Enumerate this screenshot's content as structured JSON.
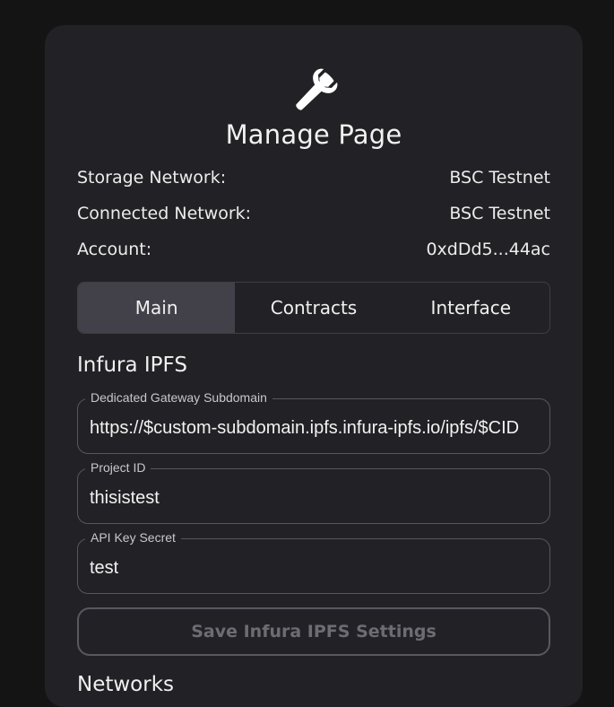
{
  "page": {
    "title": "Manage Page",
    "icon": "wrench-icon"
  },
  "info": [
    {
      "label": "Storage Network:",
      "value": "BSC Testnet"
    },
    {
      "label": "Connected Network:",
      "value": "BSC Testnet"
    },
    {
      "label": "Account:",
      "value": "0xdDd5...44ac"
    }
  ],
  "tabs": [
    {
      "label": "Main",
      "active": true
    },
    {
      "label": "Contracts",
      "active": false
    },
    {
      "label": "Interface",
      "active": false
    }
  ],
  "infura": {
    "section_title": "Infura IPFS",
    "gateway_label": "Dedicated Gateway Subdomain",
    "gateway_value": "https://$custom-subdomain.ipfs.infura-ipfs.io/ipfs/$CID",
    "project_id_label": "Project ID",
    "project_id_value": "thisistest",
    "api_key_label": "API Key Secret",
    "api_key_value": "test",
    "save_label": "Save Infura IPFS Settings"
  },
  "networks": {
    "section_title": "Networks"
  },
  "colors": {
    "background": "#141414",
    "card": "#222226",
    "active_tab": "#42414a"
  }
}
